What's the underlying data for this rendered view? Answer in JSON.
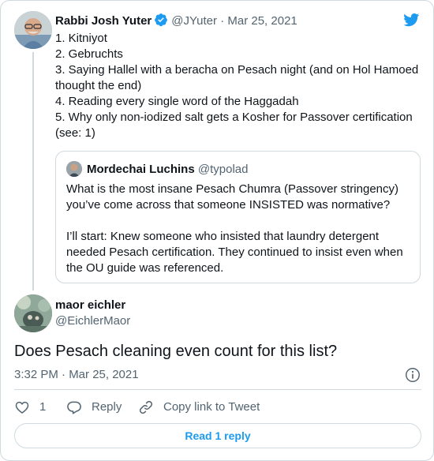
{
  "colors": {
    "brand_blue": "#1d9bf0",
    "text": "#0f1419",
    "muted": "#536471",
    "border": "#cfd9de"
  },
  "icons": {
    "logo": "twitter-bird-icon",
    "verified": "verified-badge-icon",
    "info": "info-icon",
    "like": "heart-icon",
    "reply": "reply-bubble-icon",
    "link": "link-icon"
  },
  "parent_tweet": {
    "author_name": "Rabbi Josh Yuter",
    "handle": "@JYuter",
    "separator": "·",
    "date": "Mar 25, 2021",
    "lines": [
      "1. Kitniyot",
      "2. Gebruchts",
      "3. Saying Hallel with a beracha on Pesach night (and on Hol Hamoed",
      "thought the end)",
      "4. Reading every single word of the Haggadah",
      "5. Why only non-iodized salt gets a Kosher for Passover certification",
      "(see: 1)"
    ],
    "quoted": {
      "author_name": "Mordechai Luchins",
      "handle": "@typolad",
      "lines_a": [
        "What is the most insane Pesach Chumra (Passover stringency)",
        "you’ve come across that someone INSISTED was normative?"
      ],
      "lines_b": [
        "I’ll start: Knew someone who insisted that laundry detergent",
        "needed Pesach certification. They continued to insist even when",
        "the OU guide was referenced."
      ]
    }
  },
  "reply_tweet": {
    "author_name": "maor eichler",
    "handle": "@EichlerMaor",
    "text": "Does Pesach cleaning even count for this list?",
    "timestamp": "3:32 PM · Mar 25, 2021",
    "actions": {
      "like_count": "1",
      "reply_label": "Reply",
      "copy_link_label": "Copy link to Tweet"
    },
    "read_replies_label": "Read 1 reply"
  }
}
